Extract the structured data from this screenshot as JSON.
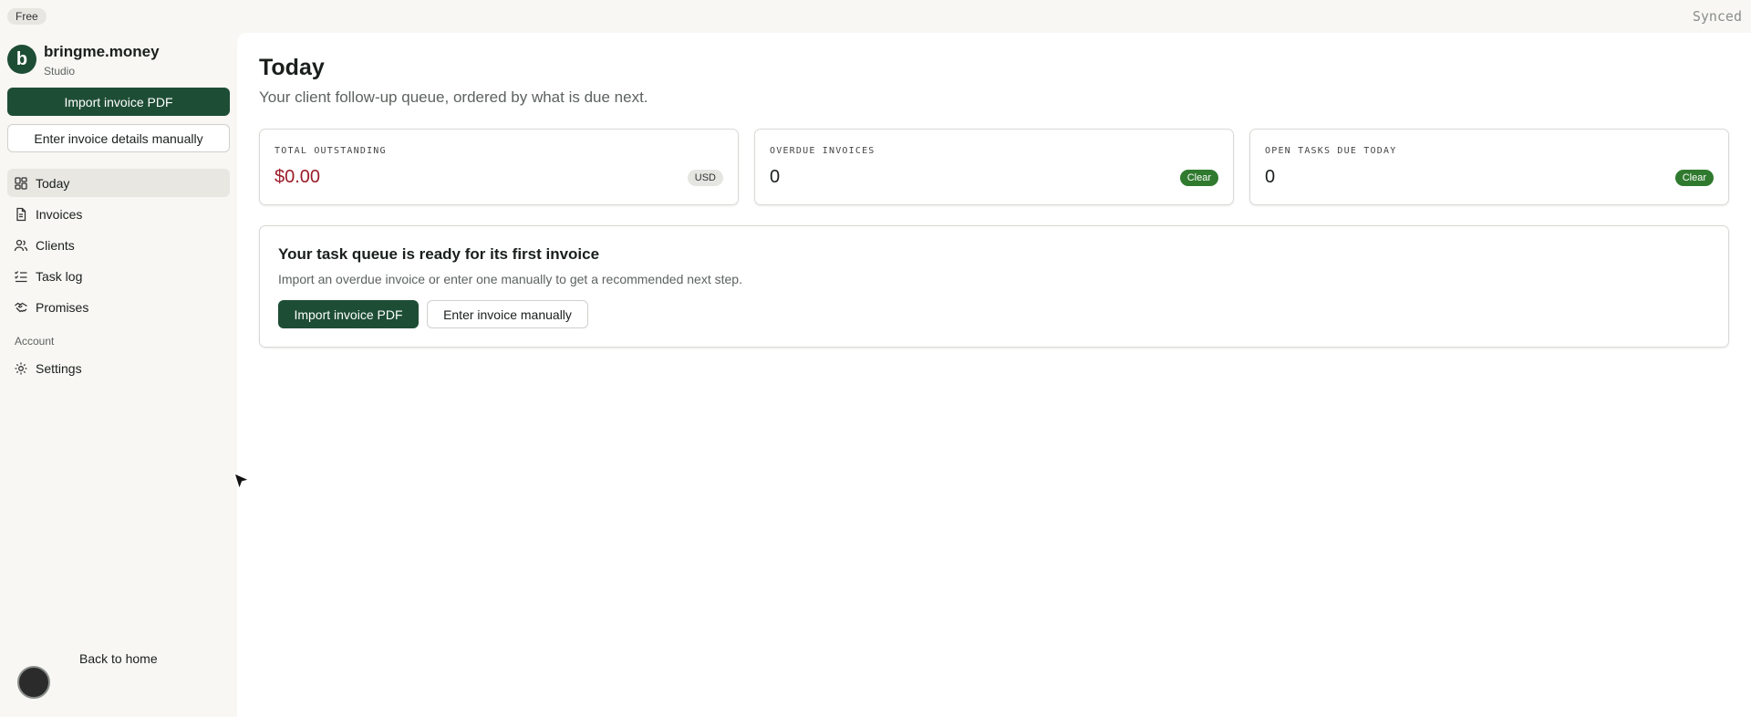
{
  "topbar": {
    "plan": "Free",
    "sync_status": "Synced"
  },
  "brand": {
    "initial": "b",
    "name": "bringme.money",
    "subtitle": "Studio"
  },
  "sidebar": {
    "import_pdf_label": "Import invoice PDF",
    "enter_manual_label": "Enter invoice details manually",
    "nav": [
      {
        "label": "Today",
        "icon": "dashboard-icon",
        "active": true
      },
      {
        "label": "Invoices",
        "icon": "document-icon"
      },
      {
        "label": "Clients",
        "icon": "users-icon"
      },
      {
        "label": "Task log",
        "icon": "checklist-icon"
      },
      {
        "label": "Promises",
        "icon": "handshake-icon"
      }
    ],
    "section_label": "Account",
    "settings": {
      "label": "Settings",
      "icon": "gear-icon"
    },
    "back_home": "Back to home"
  },
  "main": {
    "title": "Today",
    "subtitle": "Your client follow-up queue, ordered by what is due next.",
    "stats": [
      {
        "label": "TOTAL OUTSTANDING",
        "value": "$0.00",
        "badge": "USD"
      },
      {
        "label": "OVERDUE INVOICES",
        "value": "0",
        "badge": "Clear"
      },
      {
        "label": "OPEN TASKS DUE TODAY",
        "value": "0",
        "badge": "Clear"
      }
    ],
    "empty_state": {
      "title": "Your task queue is ready for its first invoice",
      "description": "Import an overdue invoice or enter one manually to get a recommended next step.",
      "import_label": "Import invoice PDF",
      "manual_label": "Enter invoice manually"
    }
  },
  "colors": {
    "brand_green": "#1e4d35",
    "badge_green": "#2f7a2f",
    "money_red": "#9b1c2a",
    "sidebar_bg": "#f8f7f3"
  }
}
